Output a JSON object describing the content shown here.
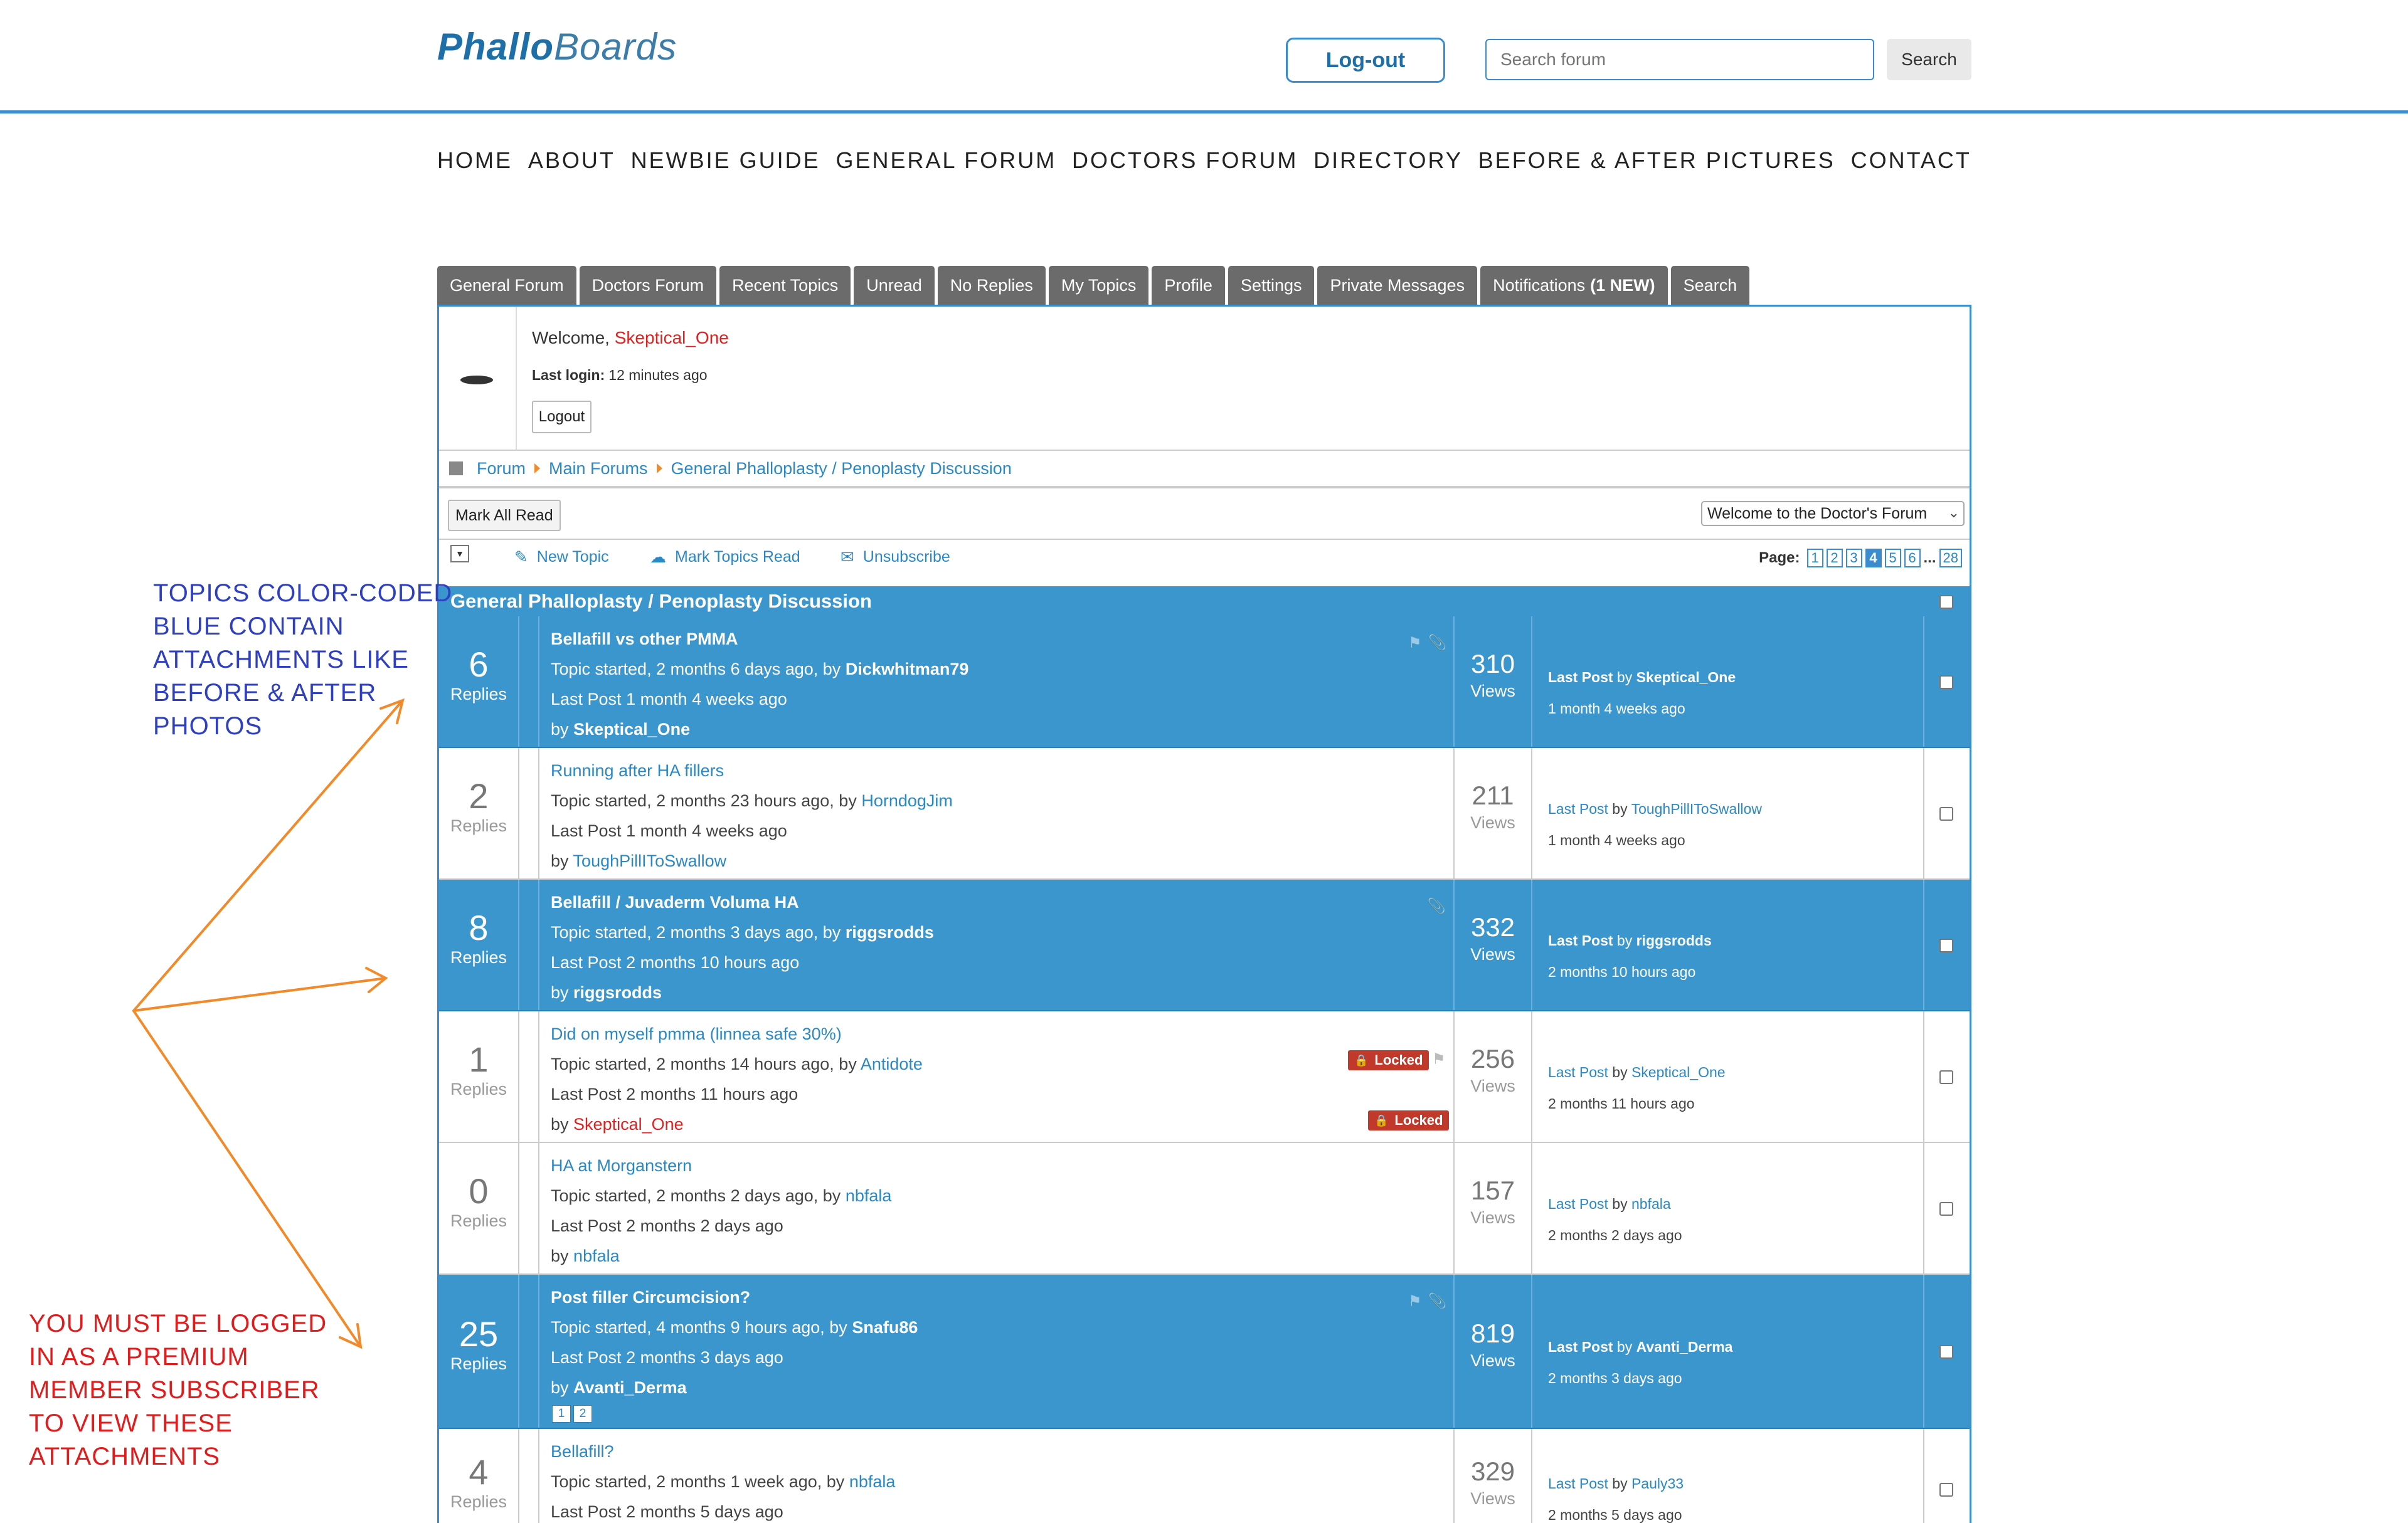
{
  "header": {
    "logo_bold": "Phallo",
    "logo_rest": "Boards",
    "logout_label": "Log-out",
    "search_placeholder": "Search forum",
    "search_label": "Search"
  },
  "main_nav": [
    "HOME",
    "ABOUT",
    "NEWBIE GUIDE",
    "GENERAL FORUM",
    "DOCTORS FORUM",
    "DIRECTORY",
    "BEFORE & AFTER PICTURES",
    "CONTACT"
  ],
  "tabs": [
    "General Forum",
    "Doctors Forum",
    "Recent Topics",
    "Unread",
    "No Replies",
    "My Topics",
    "Profile",
    "Settings",
    "Private Messages",
    "Notifications",
    "Search"
  ],
  "notifications_badge": "(1 NEW)",
  "welcome": {
    "greeting": "Welcome,",
    "user": "Skeptical_One",
    "last_login_label": "Last login:",
    "last_login_value": "12 minutes ago",
    "logout_label": "Logout"
  },
  "breadcrumb": [
    "Forum",
    "Main Forums",
    "General Phalloplasty / Penoplasty Discussion"
  ],
  "actions": {
    "mark_all_read": "Mark All Read",
    "jump_selected": "Welcome to the Doctor's Forum"
  },
  "toolbar": {
    "new_topic": "New Topic",
    "mark_topics_read": "Mark Topics Read",
    "unsubscribe": "Unsubscribe"
  },
  "pagination": {
    "label": "Page:",
    "pages": [
      "1",
      "2",
      "3",
      "4",
      "5",
      "6"
    ],
    "current": "4",
    "ellipsis": "...",
    "last": "28"
  },
  "list_title": "General Phalloplasty / Penoplasty Discussion",
  "labels": {
    "replies": "Replies",
    "views": "Views",
    "topic_started": "Topic started,",
    "by": "by",
    "last_post": "Last Post",
    "locked": "Locked"
  },
  "topics": [
    {
      "replies": "6",
      "title": "Bellafill vs other PMMA",
      "started": "2 months 6 days ago",
      "starter": "Dickwhitman79",
      "last_post_time": "1 month 4 weeks ago",
      "last_post_user": "Skeptical_One",
      "views": "310",
      "last_post_ago": "1 month 4 weeks ago"
    },
    {
      "replies": "2",
      "title": "Running after HA fillers",
      "started": "2 months 23 hours ago",
      "starter": "HorndogJim",
      "last_post_time": "1 month 4 weeks ago",
      "last_post_user": "ToughPillIToSwallow",
      "views": "211",
      "last_post_ago": "1 month 4 weeks ago"
    },
    {
      "replies": "8",
      "title": "Bellafill / Juvaderm Voluma HA",
      "started": "2 months 3 days ago",
      "starter": "riggsrodds",
      "last_post_time": "2 months 10 hours ago",
      "last_post_user": "riggsrodds",
      "views": "332",
      "last_post_ago": "2 months 10 hours ago"
    },
    {
      "replies": "1",
      "title": "Did on myself pmma (linnea safe 30%)",
      "started": "2 months 14 hours ago",
      "starter": "Antidote",
      "last_post_time": "2 months 11 hours ago",
      "last_post_user": "Skeptical_One",
      "views": "256",
      "last_post_ago": "2 months 11 hours ago"
    },
    {
      "replies": "0",
      "title": "HA at Morganstern",
      "started": "2 months 2 days ago",
      "starter": "nbfala",
      "last_post_time": "2 months 2 days ago",
      "last_post_user": "nbfala",
      "views": "157",
      "last_post_ago": "2 months 2 days ago"
    },
    {
      "replies": "25",
      "title": "Post filler Circumcision?",
      "started": "4 months 9 hours ago",
      "starter": "Snafu86",
      "last_post_time": "2 months 3 days ago",
      "last_post_user": "Avanti_Derma",
      "views": "819",
      "last_post_ago": "2 months 3 days ago",
      "mini_pages": [
        "1",
        "2"
      ]
    },
    {
      "replies": "4",
      "title": "Bellafill?",
      "started": "2 months 1 week ago",
      "starter": "nbfala",
      "last_post_time": "2 months 5 days ago",
      "last_post_user": "Pauly33",
      "views": "329",
      "last_post_ago": "2 months 5 days ago"
    }
  ],
  "annotations": {
    "blue": [
      "TOPICS COLOR-CODED",
      "BLUE CONTAIN",
      "ATTACHMENTS LIKE",
      "BEFORE & AFTER",
      "PHOTOS"
    ],
    "red": [
      "YOU MUST BE LOGGED",
      "IN AS A PREMIUM",
      "MEMBER SUBSCRIBER",
      "TO VIEW THESE",
      "ATTACHMENTS"
    ]
  },
  "colors": {
    "accent": "#3b96ce",
    "link": "#2a88c5",
    "tab": "#6b6b6b",
    "locked": "#c0392b",
    "annotation_blue": "#2e3fbf",
    "annotation_red": "#e11c1c",
    "arrow": "#f28a2a"
  },
  "icons": [
    "new-topic-icon",
    "mark-read-icon",
    "unsubscribe-icon",
    "flag-icon",
    "paperclip-icon",
    "lock-icon"
  ]
}
